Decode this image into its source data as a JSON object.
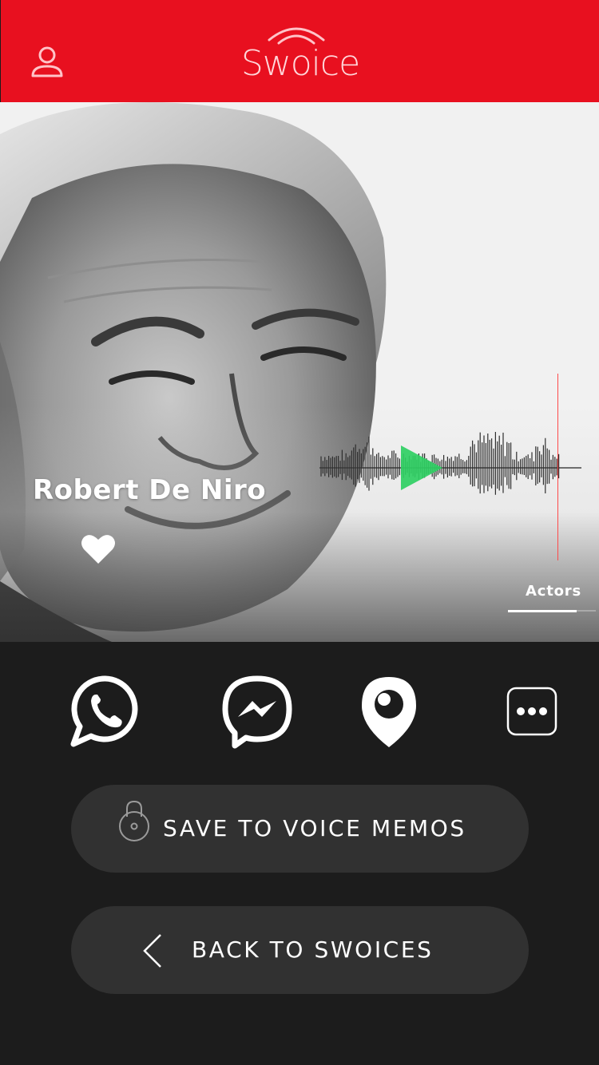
{
  "header": {
    "logo_text": "Swoice",
    "brand_color": "#e8101f",
    "profile_icon": "user-icon"
  },
  "hero": {
    "celebrity_name": "Robert De Niro",
    "favorite_icon": "heart-icon",
    "play_icon": "play-icon",
    "category_label": "Actors"
  },
  "share": {
    "items": [
      {
        "name": "whatsapp",
        "icon": "whatsapp-icon"
      },
      {
        "name": "messenger",
        "icon": "messenger-icon"
      },
      {
        "name": "periscope",
        "icon": "periscope-icon"
      },
      {
        "name": "more",
        "icon": "more-icon"
      }
    ]
  },
  "actions": {
    "save_label": "SAVE TO VOICE MEMOS",
    "save_icon": "lock-icon",
    "back_label": "BACK TO SWOICES",
    "back_icon": "chevron-left-icon"
  }
}
